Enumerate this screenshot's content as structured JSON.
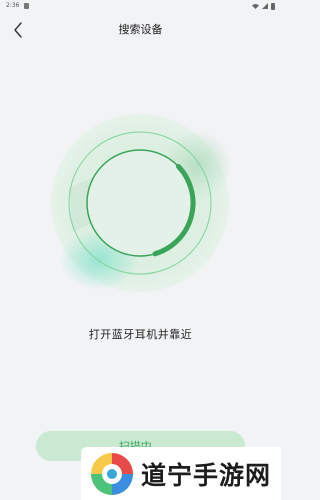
{
  "status_bar": {
    "time": "2:36"
  },
  "nav": {
    "title": "搜索设备"
  },
  "scan": {
    "hint": "打开蓝牙耳机并靠近",
    "button_label": "扫描中..."
  },
  "watermark": {
    "site_name": "道宁手游网"
  },
  "colors": {
    "accent": "#3aa55a",
    "button_bg": "#c9e9d2",
    "background": "#f2f3f5"
  }
}
